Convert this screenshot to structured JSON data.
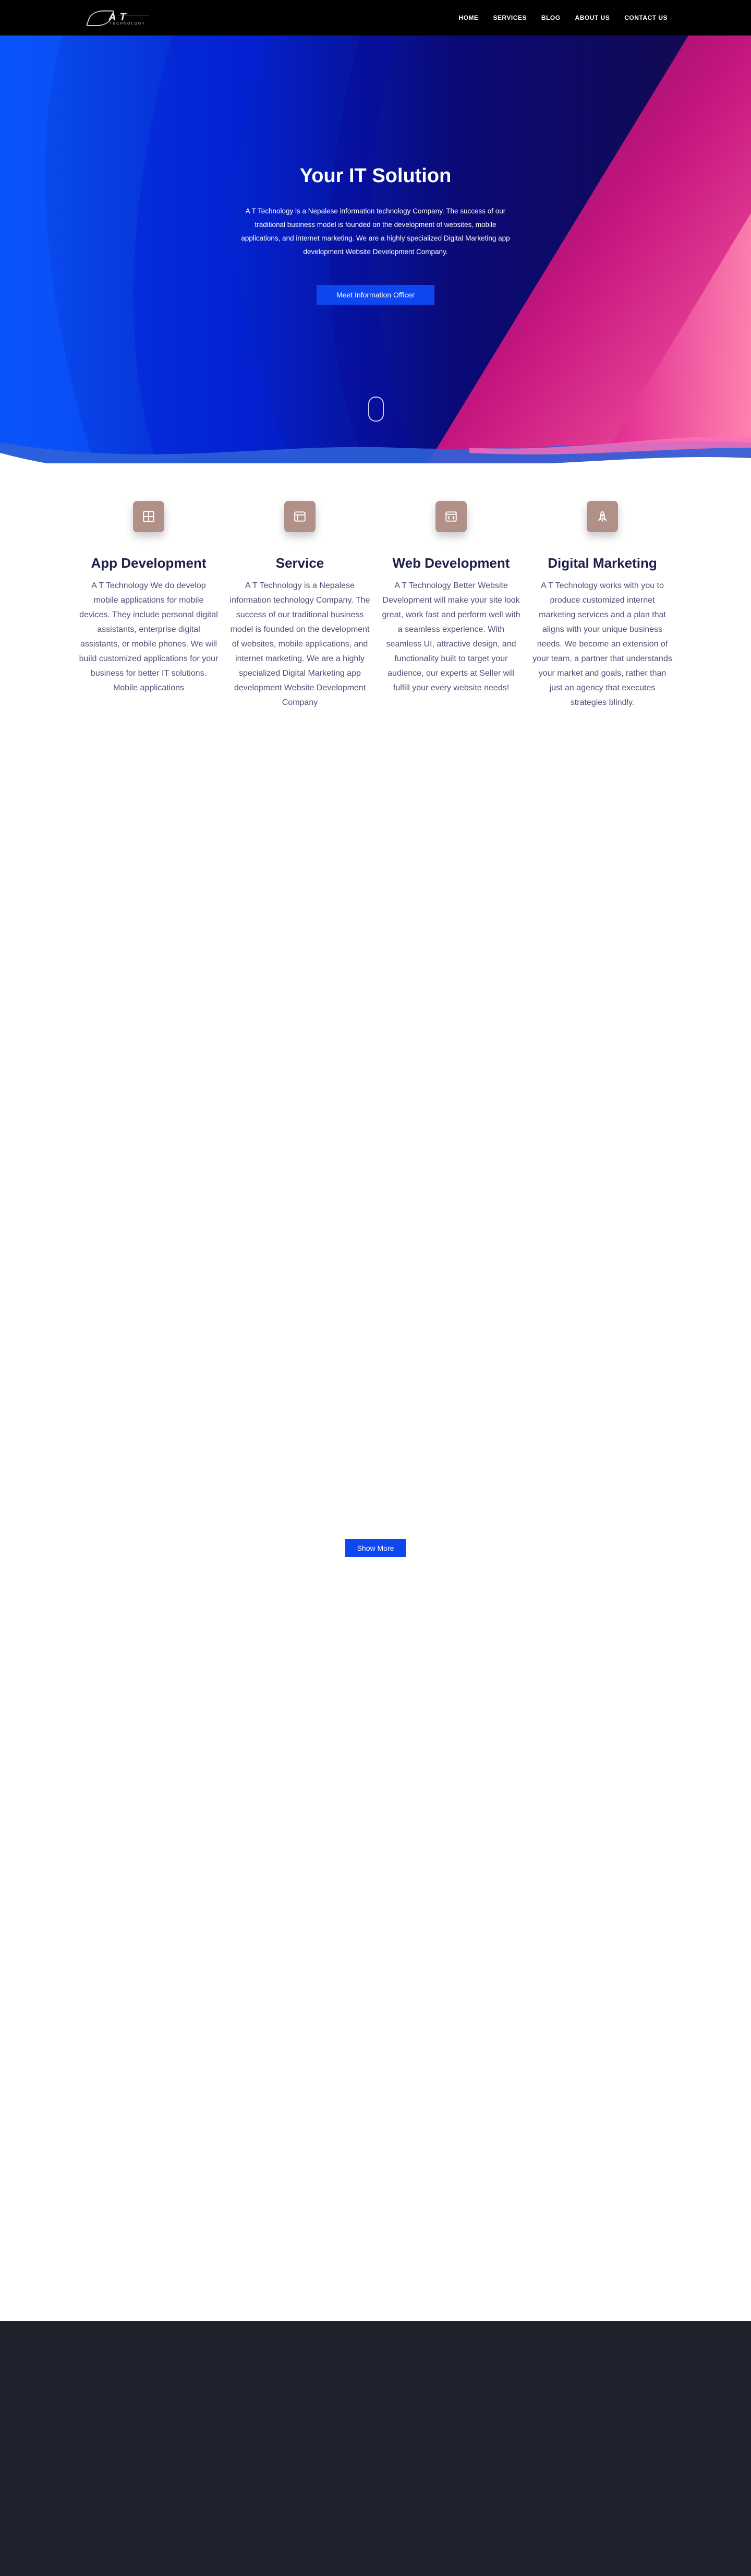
{
  "header": {
    "logo_text": "A T",
    "logo_subtext": "TECHNOLOGY",
    "nav": [
      "HOME",
      "SERVICES",
      "BLOG",
      "ABOUT US",
      "CONTACT US"
    ]
  },
  "hero": {
    "title": "Your IT Solution",
    "description": "A T Technology is a Nepalese information technology Company. The success of our traditional business model is founded on the development of websites, mobile applications, and internet marketing. We are a highly specialized Digital Marketing app development Website Development Company.",
    "button_label": "Meet Information Officer"
  },
  "features": [
    {
      "icon": "layout-grid-icon",
      "title": "App Development",
      "description": "A T Technology We do develop mobile applications for mobile devices. They include personal digital assistants, enterprise digital assistants, or mobile phones. We will build customized applications for your business for better IT solutions. Mobile applications"
    },
    {
      "icon": "browser-window-icon",
      "title": "Service",
      "description": "A T Technology is a Nepalese information technology Company. The success of our traditional business model is founded on the development of websites, mobile applications, and internet marketing. We are a highly specialized Digital Marketing app development Website Development Company"
    },
    {
      "icon": "code-window-icon",
      "title": "Web Development",
      "description": "A T Technology Better Website Development will make your site look great, work fast and perform well with a seamless experience. With seamless UI, attractive design, and functionality built to target your audience, our experts at Seller will fulfill your every website needs!"
    },
    {
      "icon": "rocket-icon",
      "title": "Digital Marketing",
      "description": "A T Technology works with you to produce customized internet marketing services and a plan that aligns with your unique business needs. We become an extension of your team, a partner that understands your market and goals, rather than just an agency that executes strategies blindly."
    }
  ],
  "show_more_label": "Show More",
  "colors": {
    "accent": "#0d47f0",
    "icon_bg": "#b19088",
    "footer_bg": "#1f212c",
    "title": "#1d1f4a"
  }
}
